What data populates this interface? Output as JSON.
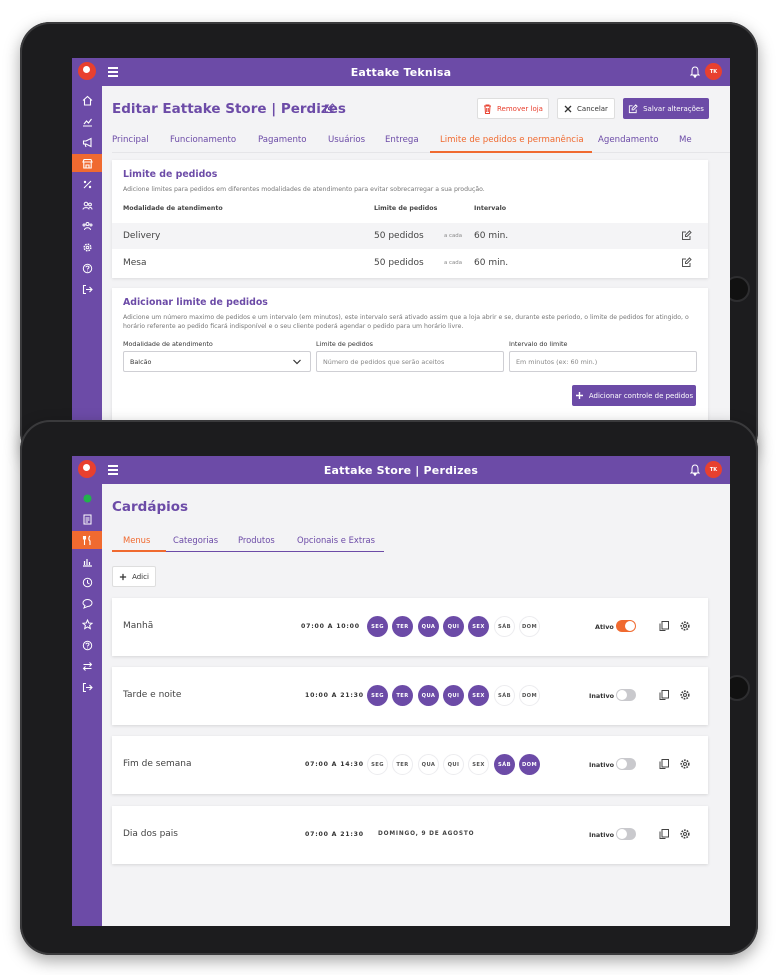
{
  "colors": {
    "purple": "#6c4ba7",
    "orange": "#f06a30",
    "red": "#e8402f"
  },
  "top": {
    "app_title": "Eattake Teknisa",
    "avatar_initials": "TK",
    "page_title": "Editar Eattake Store | Perdizes",
    "buttons": {
      "remove": "Remover loja",
      "cancel": "Cancelar",
      "save": "Salvar alterações"
    },
    "tabs": [
      "Principal",
      "Funcionamento",
      "Pagamento",
      "Usuários",
      "Entrega",
      "Limite de pedidos e permanência",
      "Agendamento",
      "Me"
    ],
    "limits": {
      "title": "Limite de pedidos",
      "desc": "Adicione limites para pedidos em diferentes modalidades de atendimento para evitar sobrecarregar a sua produção.",
      "headers": {
        "mode": "Modalidade de atendimento",
        "limit": "Limite de pedidos",
        "interval": "Intervalo"
      },
      "rows": [
        {
          "mode": "Delivery",
          "limit": "50 pedidos",
          "each": "a cada",
          "interval": "60 min."
        },
        {
          "mode": "Mesa",
          "limit": "50 pedidos",
          "each": "a cada",
          "interval": "60 min."
        }
      ]
    },
    "add_limit": {
      "title": "Adicionar limite de pedidos",
      "desc": "Adicione um número maximo de pedidos e um intervalo (em minutos), este intervalo será ativado assim que a loja abrir e se, durante este periodo, o limite de pedidos for atingido, o horário referente ao pedido ficará indisponível e o seu cliente poderá agendar o pedido para um horário livre.",
      "mode_label": "Modalidade de atendimento",
      "mode_value": "Balcão",
      "limit_label": "Limite de pedidos",
      "limit_placeholder": "Número de pedidos que serão aceitos",
      "interval_label": "Intervalo do limite",
      "interval_placeholder": "Em minutos (ex: 60 min.)",
      "submit": "Adicionar controle de pedidos"
    }
  },
  "bottom": {
    "app_title": "Eattake Store | Perdizes",
    "avatar_initials": "TK",
    "page_title": "Cardápios",
    "tabs": [
      "Menus",
      "Categorias",
      "Produtos",
      "Opcionais e Extras"
    ],
    "add_label": "Adici",
    "days": [
      "SEG",
      "TER",
      "QUA",
      "QUI",
      "SEX",
      "SÁB",
      "DOM"
    ],
    "menus": [
      {
        "name": "Manhã",
        "time": "07:00 A 10:00",
        "days_on": [
          true,
          true,
          true,
          true,
          true,
          false,
          false
        ],
        "status": "Ativo",
        "active": true
      },
      {
        "name": "Tarde e noite",
        "time": "10:00 A 21:30",
        "days_on": [
          true,
          true,
          true,
          true,
          true,
          false,
          false
        ],
        "status": "Inativo",
        "active": false
      },
      {
        "name": "Fim de semana",
        "time": "07:00 A 14:30",
        "days_on": [
          false,
          false,
          false,
          false,
          false,
          true,
          true
        ],
        "status": "Inativo",
        "active": false
      },
      {
        "name": "Dia dos pais",
        "time": "07:00 A 21:30",
        "date": "DOMINGO, 9 DE AGOSTO",
        "status": "Inativo",
        "active": false
      }
    ]
  }
}
